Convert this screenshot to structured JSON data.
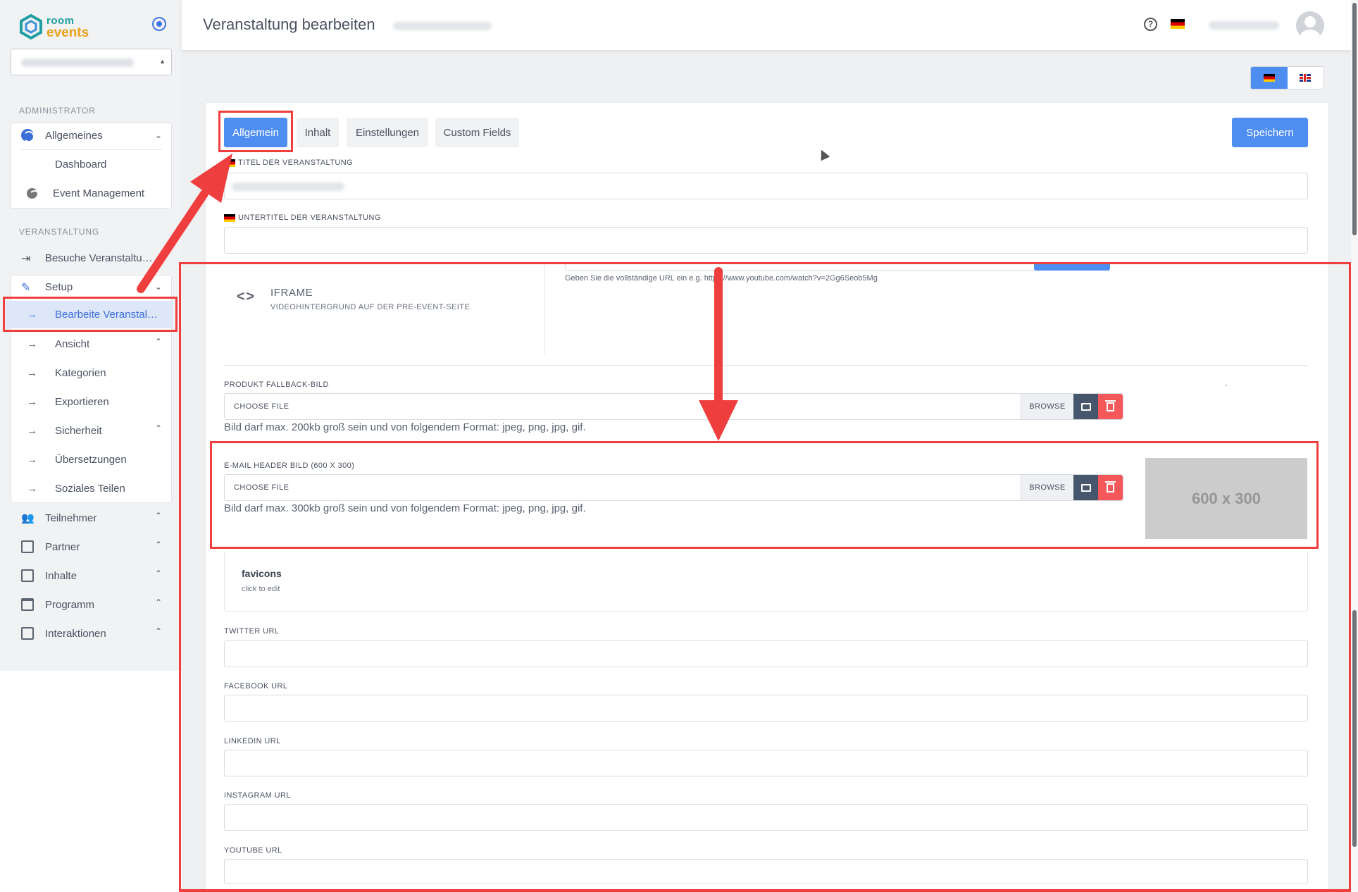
{
  "sidebar": {
    "logo_line1": "room",
    "logo_line2": "events",
    "section_admin": "ADMINISTRATOR",
    "section_event": "VERANSTALTUNG",
    "admin_items": [
      {
        "label": "Allgemeines",
        "icon": "globe-icon"
      },
      {
        "label": "Dashboard",
        "icon": "dashboard-icon"
      },
      {
        "label": "Event Management",
        "icon": "globe-icon"
      }
    ],
    "event_items": [
      {
        "label": "Besuche Veranstaltu…",
        "icon": "login-icon"
      },
      {
        "label": "Setup",
        "icon": "pencil-icon"
      }
    ],
    "setup_items": [
      {
        "label": "Bearbeite Veranstal…"
      },
      {
        "label": "Ansicht"
      },
      {
        "label": "Kategorien"
      },
      {
        "label": "Exportieren"
      },
      {
        "label": "Sicherheit"
      },
      {
        "label": "Übersetzungen"
      },
      {
        "label": "Soziales Teilen"
      }
    ],
    "bottom_items": [
      {
        "label": "Teilnehmer",
        "icon": "users-icon"
      },
      {
        "label": "Partner",
        "icon": "building-icon"
      },
      {
        "label": "Inhalte",
        "icon": "book-icon"
      },
      {
        "label": "Programm",
        "icon": "calendar-icon"
      },
      {
        "label": "Interaktionen",
        "icon": "plus-box-icon"
      }
    ]
  },
  "header": {
    "title": "Veranstaltung bearbeiten",
    "help": "?"
  },
  "tabs": [
    {
      "label": "Allgemein"
    },
    {
      "label": "Inhalt"
    },
    {
      "label": "Einstellungen"
    },
    {
      "label": "Custom Fields"
    }
  ],
  "save_label": "Speichern",
  "fields": {
    "title_label": "TITEL DER VERANSTALTUNG",
    "subtitle_label": "UNTERTITEL DER VERANSTALTUNG",
    "iframe_title": "IFRAME",
    "iframe_sub": "VIDEOHINTERGRUND AUF DER PRE-EVENT-SEITE",
    "iframe_help": "Geben Sie die vollständige URL ein e.g. https://www.youtube.com/watch?v=2Gg6Seob5Mg",
    "fallback_label": "PRODUKT FALLBACK-BILD",
    "choose_file": "CHOOSE FILE",
    "browse": "BROWSE",
    "fallback_hint": "Bild darf max. 200kb groß sein und von folgendem Format: jpeg, png, jpg, gif.",
    "email_header_label": "E-MAIL HEADER BILD (600 X 300)",
    "email_header_hint": "Bild darf max. 300kb groß sein und von folgendem Format: jpeg, png, jpg, gif.",
    "placeholder_image_text": "600 x 300",
    "favicons_title": "favicons",
    "favicons_sub": "click to edit",
    "twitter_label": "TWITTER URL",
    "facebook_label": "FACEBOOK URL",
    "linkedin_label": "LINKEDIN URL",
    "instagram_label": "INSTAGRAM URL",
    "youtube_label": "YOUTUBE URL"
  },
  "colors": {
    "accent": "#4e8ef0",
    "annotation": "#ef3e3e",
    "danger": "#f4585b"
  }
}
